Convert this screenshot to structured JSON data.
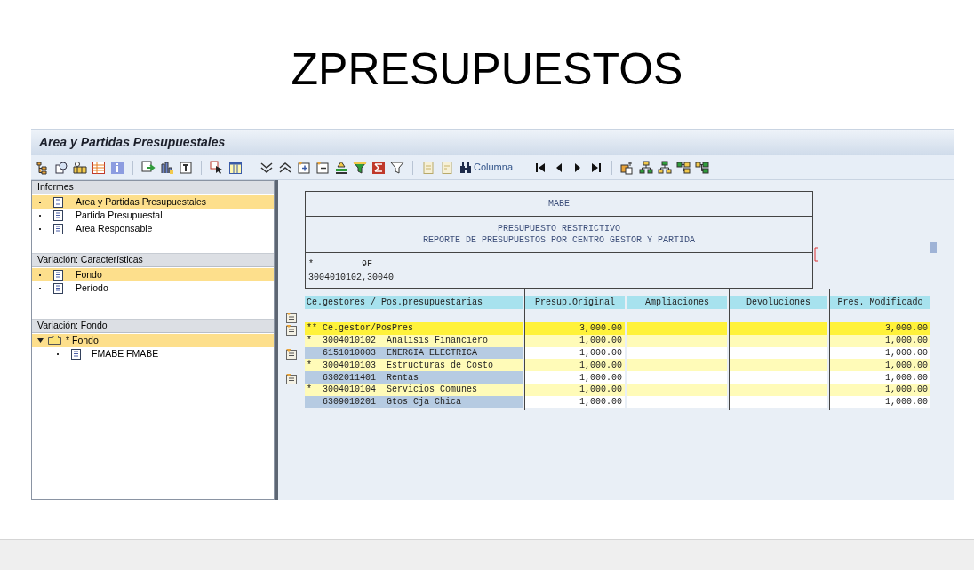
{
  "slide_title": "ZPRESUPUESTOS",
  "window": {
    "title": "Area y Partidas Presupuestales"
  },
  "toolbar": {
    "column_button": "Columna"
  },
  "sidebar": {
    "sections": [
      {
        "title": "Informes",
        "items": [
          {
            "label": "Area y Partidas Presupuestales",
            "selected": true
          },
          {
            "label": "Partida Presupuestal",
            "selected": false
          },
          {
            "label": "Area Responsable",
            "selected": false
          }
        ]
      },
      {
        "title": "Variación: Características",
        "items": [
          {
            "label": "Fondo",
            "selected": true
          },
          {
            "label": "Período",
            "selected": false
          }
        ]
      },
      {
        "title": "Variación: Fondo",
        "tree": [
          {
            "label": "* Fondo",
            "selected": true,
            "expanded": true,
            "children": [
              {
                "label": "FMABE FMABE",
                "selected": false
              }
            ]
          }
        ]
      }
    ]
  },
  "report": {
    "company": "MABE",
    "title_lines": [
      "PRESUPUESTO RESTRICTIVO",
      "REPORTE DE PRESUPUESTOS POR CENTRO GESTOR Y PARTIDA"
    ],
    "info_lines": [
      "*         9F",
      "3004010102,30040"
    ],
    "columns": [
      "Ce.gestores / Pos.presupuestarias",
      "Presup.Original",
      "Ampliaciones",
      "Devoluciones",
      "Pres. Modificado"
    ],
    "rows": [
      {
        "kind": "total",
        "label": "** Ce.gestor/PosPres",
        "presup_original": "3,000.00",
        "pres_modificado": "3,000.00"
      },
      {
        "kind": "group",
        "label": "*  3004010102  Analisis Financiero",
        "presup_original": "1,000.00",
        "pres_modificado": "1,000.00"
      },
      {
        "kind": "item",
        "label": "   6151010003  ENERGIA ELECTRICA",
        "presup_original": "1,000.00",
        "pres_modificado": "1,000.00"
      },
      {
        "kind": "group",
        "label": "*  3004010103  Estructuras de Costo",
        "presup_original": "1,000.00",
        "pres_modificado": "1,000.00"
      },
      {
        "kind": "item",
        "label": "   6302011401  Rentas",
        "presup_original": "1,000.00",
        "pres_modificado": "1,000.00"
      },
      {
        "kind": "group",
        "label": "*  3004010104  Servicios Comunes",
        "presup_original": "1,000.00",
        "pres_modificado": "1,000.00"
      },
      {
        "kind": "item",
        "label": "   6309010201  Gtos Cja Chica",
        "presup_original": "1,000.00",
        "pres_modificado": "1,000.00"
      }
    ]
  }
}
